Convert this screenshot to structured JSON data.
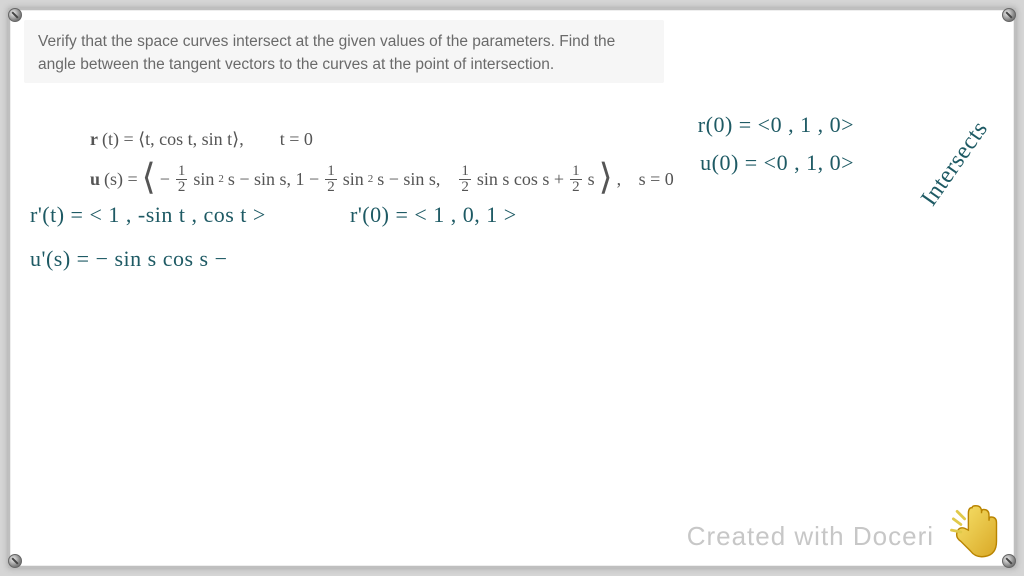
{
  "problem": {
    "text": "Verify that the space curves intersect at the given values of the parameters. Find the angle between the tangent vectors to the curves at the point of intersection."
  },
  "equations": {
    "r_lhs": "r",
    "r_of": "(t) = ⟨t, cos t, sin t⟩,",
    "r_param": "t = 0",
    "u_lhs": "u",
    "u_of": "(s) = ",
    "u_term1a": "sin",
    "u_term1b": " s − sin s,  1 − ",
    "u_term2a": "sin",
    "u_term2b": " s − sin s,",
    "u_term3a": "sin s cos s + ",
    "u_term3b": "s",
    "u_param": "s = 0",
    "half_num": "1",
    "half_den": "2",
    "sup2": "2"
  },
  "handwriting": {
    "line1": "r(0) = <0 , 1 , 0>",
    "line2": "u(0) = <0 , 1, 0>",
    "intersects": "Intersects",
    "line3": "r'(t) = < 1 , -sin t , cos t >",
    "line3b": "r'(0) = < 1 , 0, 1 >",
    "line4": "u'(s) = − sin s cos s −"
  },
  "watermark": "Created with Doceri",
  "icons": {
    "finger": "pointing-hand-icon"
  }
}
